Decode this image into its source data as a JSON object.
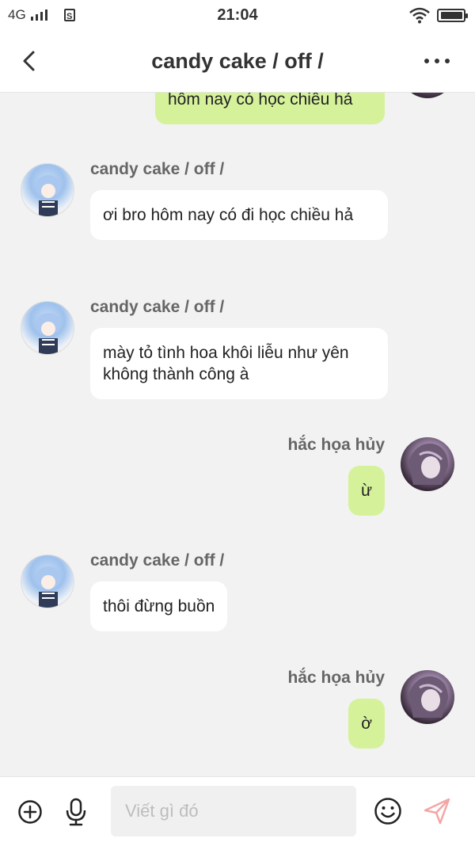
{
  "status_bar": {
    "network": "4G",
    "sim_label": "S",
    "time": "21:04",
    "battery_level": 0.95
  },
  "header": {
    "title": "candy cake / off /"
  },
  "messages": [
    {
      "side": "out",
      "sender": "",
      "text": "hôm nay có học chiều hả"
    },
    {
      "side": "in",
      "sender": "candy cake / off /",
      "text": "ơi bro hôm nay có đi học chiều hả"
    },
    {
      "side": "in",
      "sender": "candy cake / off /",
      "text": "mày tỏ tình hoa khôi liễu như yên không thành công à"
    },
    {
      "side": "out",
      "sender": "hắc họa hủy",
      "text": "ừ"
    },
    {
      "side": "in",
      "sender": "candy cake / off /",
      "text": "thôi đừng buồn"
    },
    {
      "side": "out",
      "sender": "hắc họa hủy",
      "text": "ờ"
    }
  ],
  "composer": {
    "placeholder": "Viết gì đó"
  },
  "colors": {
    "outgoing_bubble": "#d5f29a",
    "incoming_bubble": "#ffffff",
    "send_icon": "#f4a6a6"
  }
}
